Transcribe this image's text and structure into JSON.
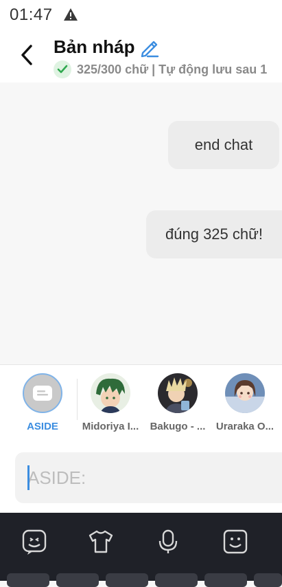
{
  "status_bar": {
    "time": "01:47",
    "warning_icon": "warning-triangle-icon"
  },
  "header": {
    "back_icon": "chevron-left-icon",
    "title": "Bản nháp",
    "edit_icon": "pencil-icon",
    "check_icon": "check-icon",
    "subtitle": "325/300 chữ | Tự động lưu sau 1"
  },
  "messages": [
    {
      "text": "end chat"
    },
    {
      "text": "đúng 325 chữ!"
    }
  ],
  "characters": [
    {
      "name": "ASIDE",
      "icon": "aside-card-icon",
      "selected": true
    },
    {
      "name": "Midoriya I...",
      "avatar": "green-hair-avatar"
    },
    {
      "name": "Bakugo - ...",
      "avatar": "blonde-hair-avatar"
    },
    {
      "name": "Uraraka O...",
      "avatar": "brown-hair-avatar"
    }
  ],
  "composer": {
    "placeholder": "ASIDE:",
    "value": ""
  },
  "keyboard_toolbar": [
    "emoji-sticker-icon",
    "tshirt-icon",
    "microphone-icon",
    "smiley-icon"
  ],
  "colors": {
    "accent": "#3b8de0",
    "check_green": "#2fa84f",
    "keyboard_bg": "#1f2128"
  }
}
